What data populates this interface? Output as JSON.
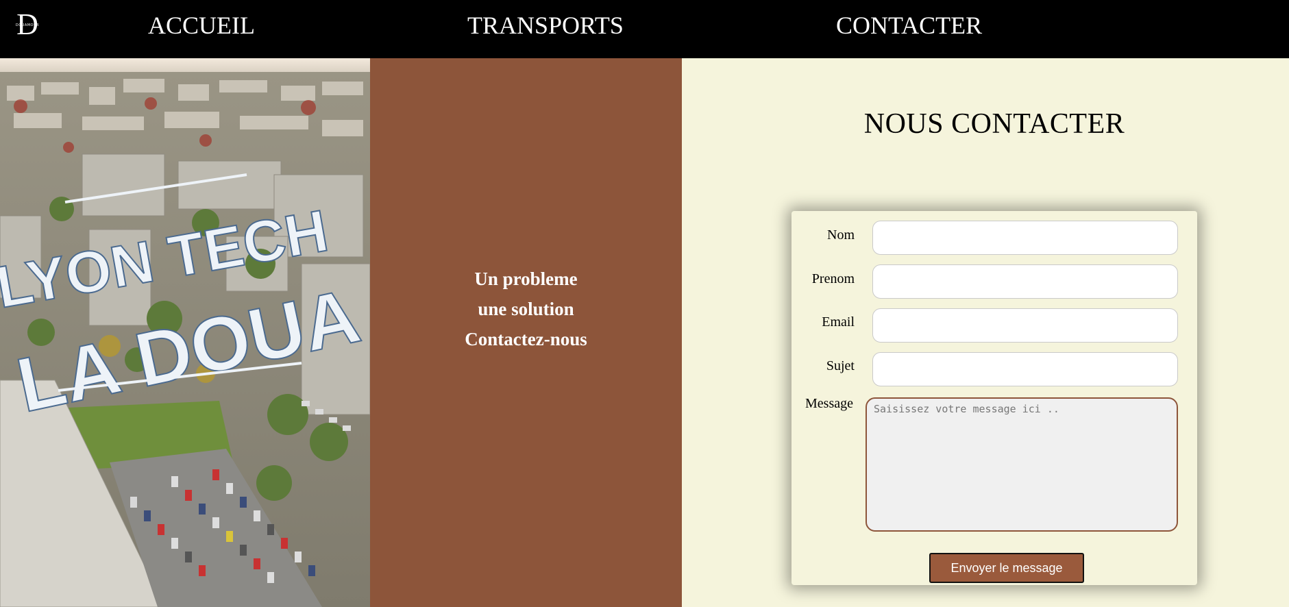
{
  "nav": {
    "logo_letter": "D",
    "logo_text": "DOUAMOUR",
    "links": [
      {
        "label": "ACCUEIL"
      },
      {
        "label": "TRANSPORTS"
      },
      {
        "label": "CONTACTER"
      }
    ]
  },
  "hero_image": {
    "overlay_line1": "LYON TECH",
    "overlay_line2": "LA DOUA"
  },
  "promo": {
    "line1": "Un probleme",
    "line2": "une solution",
    "line3": "Contactez-nous"
  },
  "contact": {
    "title": "NOUS CONTACTER",
    "fields": {
      "nom_label": "Nom",
      "nom_value": "",
      "prenom_label": "Prenom",
      "prenom_value": "",
      "email_label": "Email",
      "email_value": "",
      "sujet_label": "Sujet",
      "sujet_value": "",
      "message_label": "Message",
      "message_placeholder": "Saisissez votre message ici .."
    },
    "submit_label": "Envoyer le message"
  },
  "colors": {
    "nav_bg": "#000000",
    "brown": "#8d553a",
    "cream": "#f5f4dc",
    "button": "#9a5a3c"
  }
}
